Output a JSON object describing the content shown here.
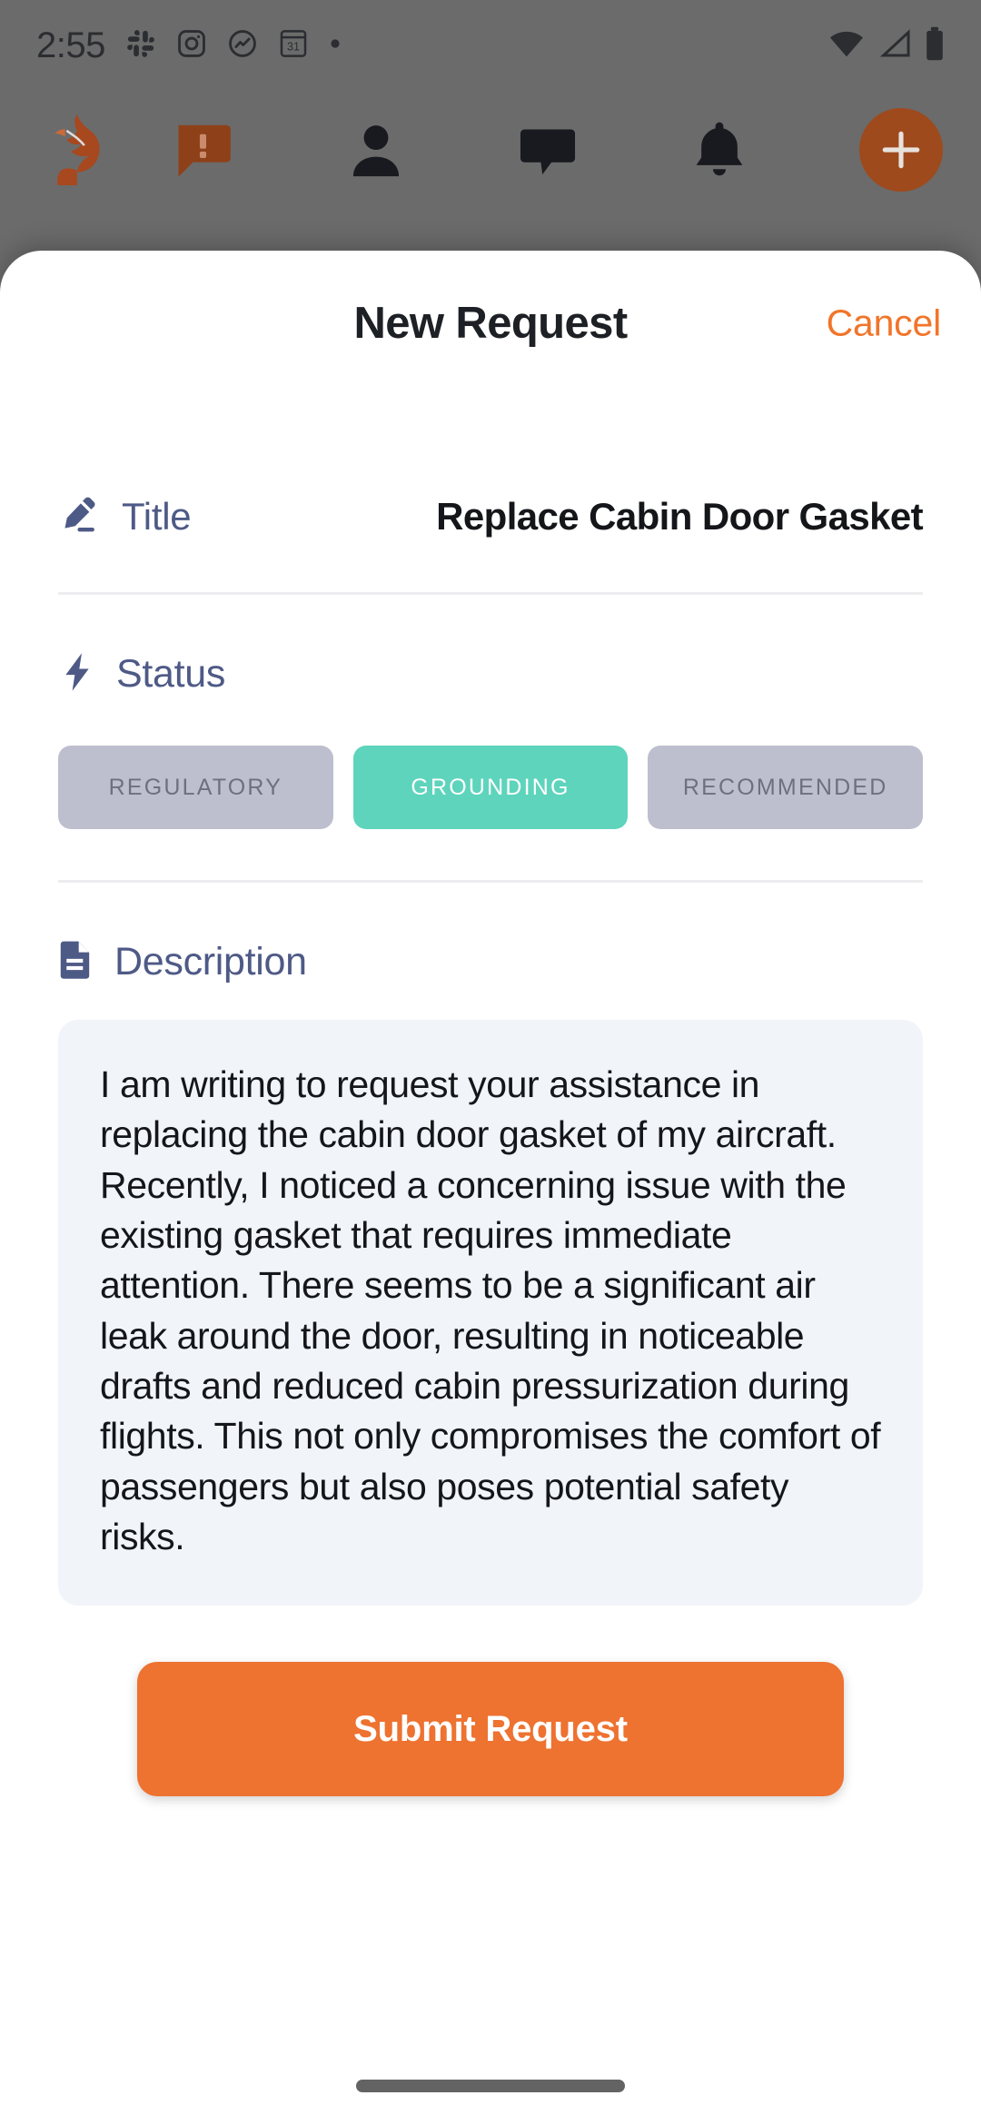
{
  "status_bar": {
    "time": "2:55",
    "left_icons": [
      "slack-icon",
      "instagram-icon",
      "activity-icon",
      "calendar-icon",
      "dot-icon"
    ],
    "calendar_day": "31",
    "right_icons": [
      "wifi-icon",
      "cellular-signal-icon",
      "battery-icon"
    ]
  },
  "top_nav": {
    "logo": "fox-logo",
    "items": [
      {
        "name": "alert-bubble-icon",
        "label": "Alerts"
      },
      {
        "name": "profile-icon",
        "label": "Profile"
      },
      {
        "name": "chat-bubble-icon",
        "label": "Messages"
      },
      {
        "name": "bell-icon",
        "label": "Notifications"
      }
    ],
    "fab_label": "+",
    "fab_color": "#9e4a1c"
  },
  "sheet": {
    "title": "New Request",
    "cancel_label": "Cancel"
  },
  "title_field": {
    "icon": "pencil-icon",
    "label": "Title",
    "value": "Replace Cabin Door Gasket",
    "placeholder": "Replace Cabin Door Gasket"
  },
  "status_field": {
    "icon": "lightning-bolt-icon",
    "label": "Status",
    "selected": "GROUNDING",
    "options": [
      {
        "label": "REGULATORY",
        "selected": false
      },
      {
        "label": "GROUNDING",
        "selected": true
      },
      {
        "label": "RECOMMENDED",
        "selected": false
      }
    ]
  },
  "description_field": {
    "icon": "document-icon",
    "label": "Description",
    "value": "I am writing to request your assistance in replacing the cabin door gasket of my aircraft. Recently, I noticed a concerning issue with the existing gasket that requires immediate attention. There seems to be a significant air leak around the door, resulting in noticeable drafts and reduced cabin pressurization during flights. This not only compromises the comfort of passengers but also poses potential safety risks."
  },
  "submit": {
    "label": "Submit Request"
  },
  "colors": {
    "accent_orange": "#ee7230",
    "cancel_orange": "#f1752a",
    "label_slate": "#4e5a86",
    "chip_selected_teal": "#5ed4bc",
    "chip_idle_gray": "#bdbfce",
    "description_bg": "#f1f4f8"
  }
}
